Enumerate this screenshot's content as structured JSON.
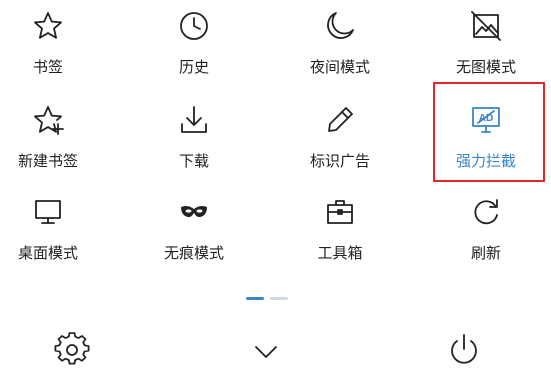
{
  "colors": {
    "icon": "#222222",
    "accent": "#3a86c8",
    "highlight_border": "#e02828",
    "indicator_active": "#3a86c8",
    "indicator_inactive": "#cfd8e3"
  },
  "menu": {
    "items": [
      {
        "label": "书签",
        "icon": "star-icon"
      },
      {
        "label": "历史",
        "icon": "clock-icon"
      },
      {
        "label": "夜间模式",
        "icon": "moon-icon"
      },
      {
        "label": "无图模式",
        "icon": "no-image-icon"
      },
      {
        "label": "新建书签",
        "icon": "star-plus-icon"
      },
      {
        "label": "下载",
        "icon": "download-icon"
      },
      {
        "label": "标识广告",
        "icon": "pencil-icon"
      },
      {
        "label": "强力拦截",
        "icon": "ad-block-icon",
        "highlighted": true
      },
      {
        "label": "桌面模式",
        "icon": "desktop-icon"
      },
      {
        "label": "无痕模式",
        "icon": "mask-icon"
      },
      {
        "label": "工具箱",
        "icon": "toolbox-icon"
      },
      {
        "label": "刷新",
        "icon": "refresh-icon"
      }
    ]
  },
  "pager": {
    "pages": 2,
    "current_page": 1
  },
  "bottom_bar": {
    "settings_icon": "gear-icon",
    "collapse_icon": "chevron-down-icon",
    "exit_icon": "power-icon"
  }
}
